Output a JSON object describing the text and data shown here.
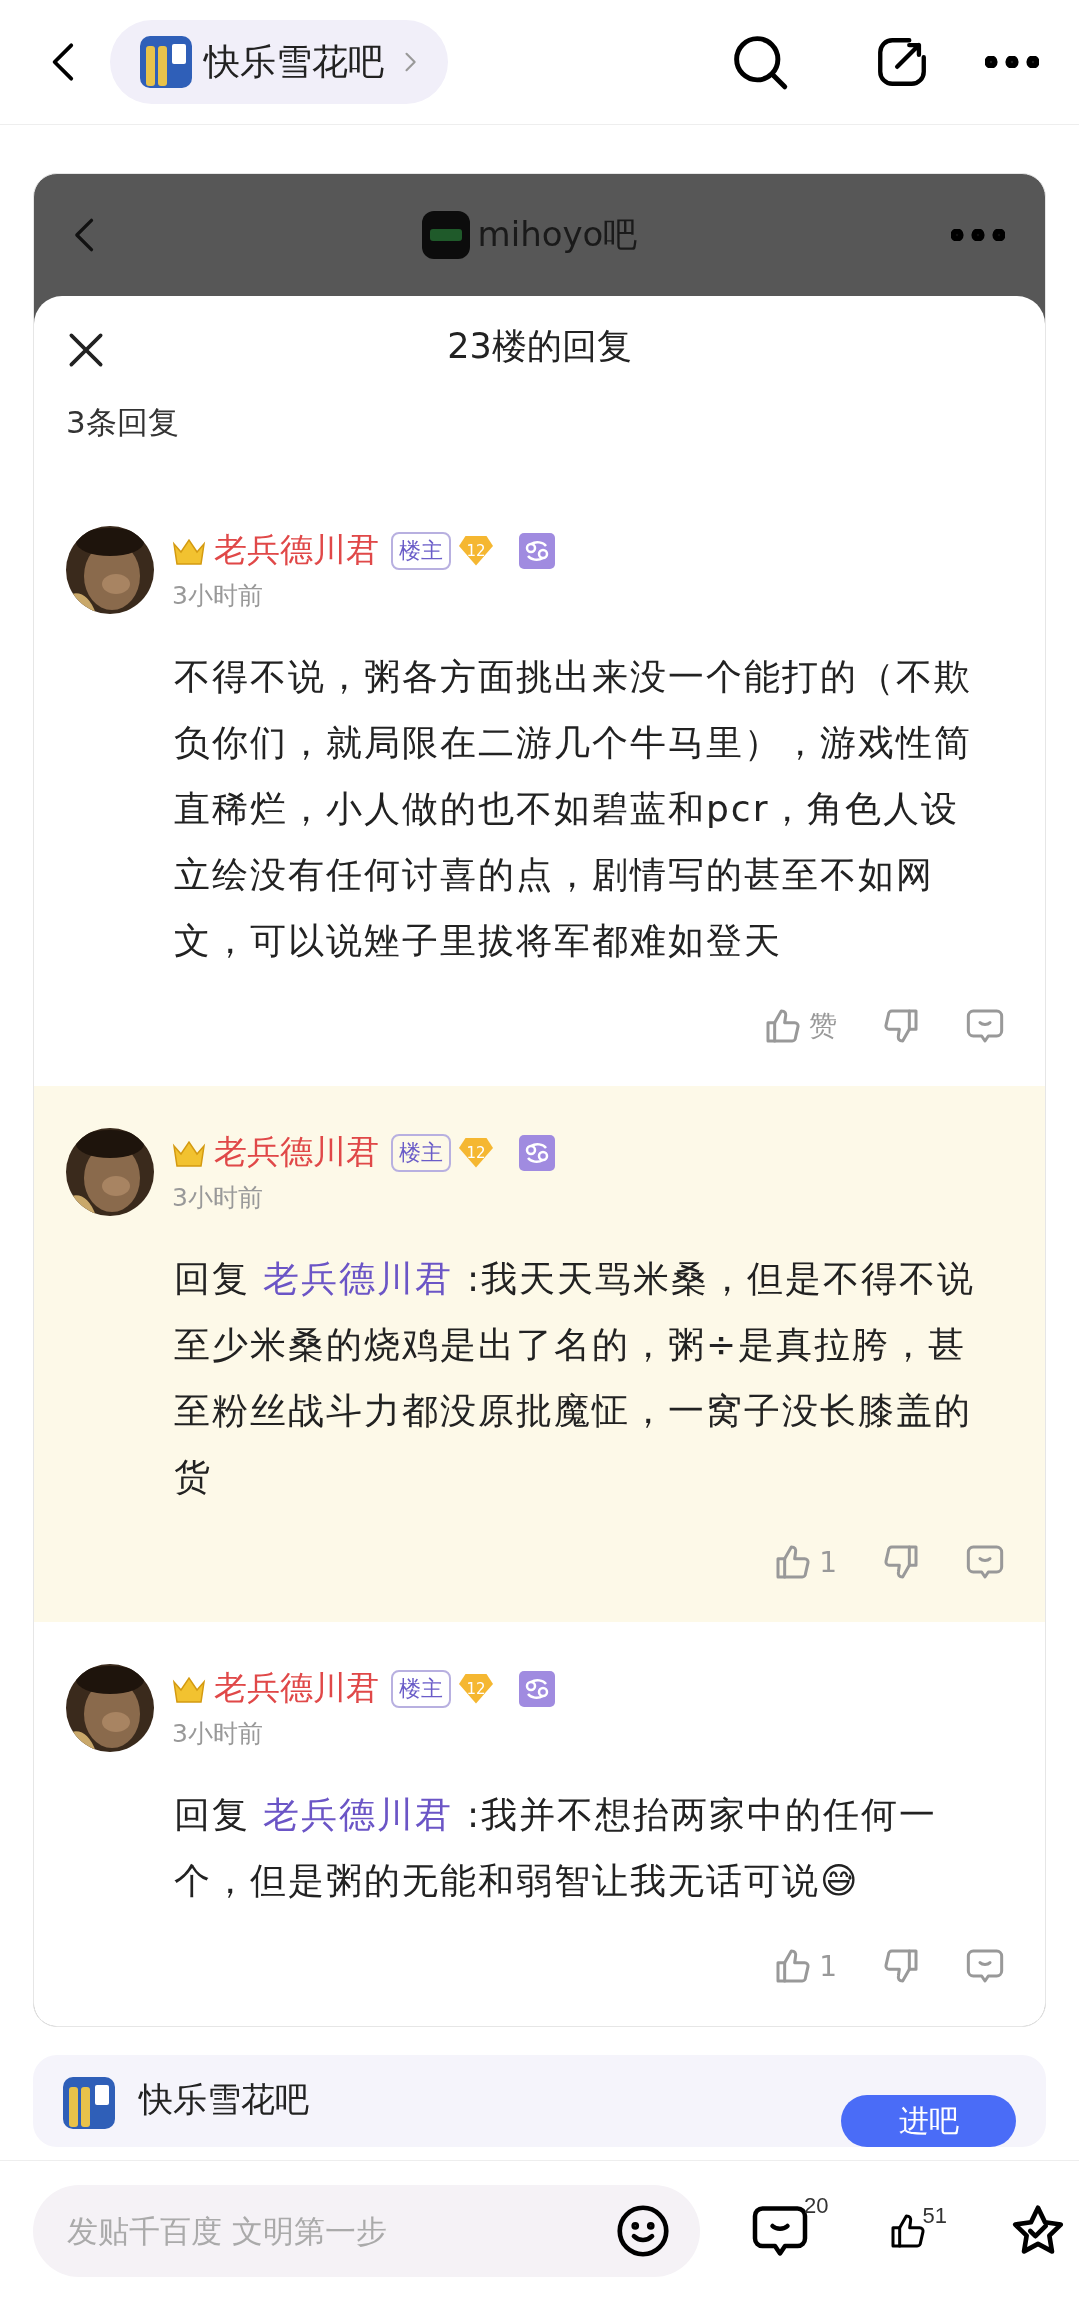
{
  "top_bar": {
    "forum": "快乐雪花吧"
  },
  "screenshot": {
    "forum": "mihoyo吧",
    "sheet": {
      "title": "23楼的回复",
      "count": "3条回复",
      "comments": [
        {
          "user": "老兵德川君",
          "role": "楼主",
          "level": "12",
          "time": "3小时前",
          "highlighted": false,
          "text": "不得不说，粥各方面挑出来没一个能打的（不欺负你们，就局限在二游几个牛马里），游戏性简直稀烂，小人做的也不如碧蓝和pcr，角色人设立绘没有任何讨喜的点，剧情写的甚至不如网文，可以说矬子里拔将军都难如登天",
          "likes": "赞"
        },
        {
          "user": "老兵德川君",
          "role": "楼主",
          "level": "12",
          "time": "3小时前",
          "highlighted": true,
          "reply_prefix": "回复",
          "reply_to": "老兵德川君",
          "text": " :我天天骂米桑，但是不得不说至少米桑的烧鸡是出了名的，粥÷是真拉胯，甚至粉丝战斗力都没原批魔怔，一窝子没长膝盖的货",
          "likes": "1"
        },
        {
          "user": "老兵德川君",
          "role": "楼主",
          "level": "12",
          "time": "3小时前",
          "highlighted": false,
          "reply_prefix": "回复",
          "reply_to": "老兵德川君",
          "text": " :我并不想抬两家中的任何一个，但是粥的无能和弱智让我无话可说😅",
          "likes": "1"
        }
      ]
    }
  },
  "forum_card": {
    "name": "快乐雪花吧",
    "button": "进吧"
  },
  "bottom_bar": {
    "placeholder": "发贴千百度 文明第一步",
    "comment_count": "20",
    "like_count": "51"
  }
}
